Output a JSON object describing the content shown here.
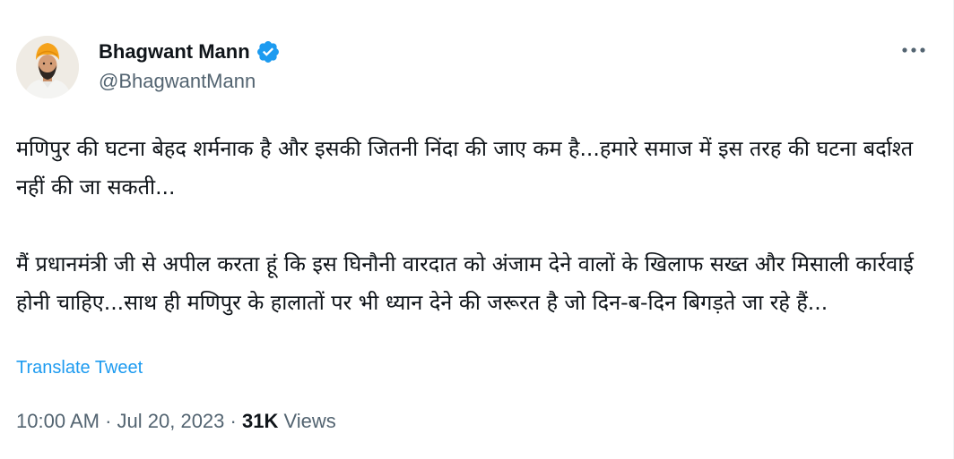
{
  "author": {
    "display_name": "Bhagwant Mann",
    "handle": "@BhagwantMann",
    "verified": true
  },
  "tweet": {
    "paragraphs": [
      "मणिपुर की घटना बेहद शर्मनाक है और इसकी जितनी निंदा की जाए कम है...हमारे समाज में इस तरह की घटना बर्दाश्त नहीं की जा सकती...",
      "मैं प्रधानमंत्री जी से अपील करता हूं कि इस घिनौनी वारदात को अंजाम देने वालों के खिलाफ सख्त और मिसाली कार्रवाई होनी चाहिए...साथ ही मणिपुर के हालातों पर भी ध्यान देने की जरूरत है जो दिन-ब-दिन बिगड़ते जा रहे हैं..."
    ],
    "translate_label": "Translate Tweet"
  },
  "meta": {
    "time": "10:00 AM",
    "separator": "·",
    "date": "Jul 20, 2023",
    "views_count": "31K",
    "views_label": "Views"
  },
  "icons": {
    "verified": "verified-badge-icon",
    "more": "more-options-icon"
  },
  "colors": {
    "verified_blue": "#1d9bf0",
    "link_blue": "#1d9bf0",
    "secondary_text": "#536471",
    "primary_text": "#0f1419",
    "turban_saffron": "#f5a21a"
  }
}
